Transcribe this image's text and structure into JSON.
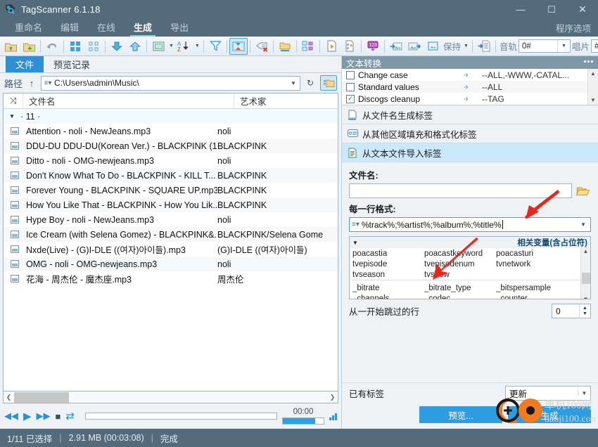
{
  "window": {
    "title": "TagScanner 6.1.18",
    "app_icon": "tag-icon",
    "minimize": "—",
    "maximize": "☐",
    "close": "✕"
  },
  "menubar": {
    "items": [
      {
        "label": "重命名",
        "active": false
      },
      {
        "label": "编辑",
        "active": false
      },
      {
        "label": "在线",
        "active": false
      },
      {
        "label": "生成",
        "active": true
      },
      {
        "label": "导出",
        "active": false
      }
    ],
    "program_options": "程序选项"
  },
  "toolbar": {
    "icons": [
      "open-folder-icon",
      "add-folder-icon",
      "undo-icon",
      "large-icons-icon",
      "small-icons-icon",
      "move-down-icon",
      "move-up-icon",
      "select-box-icon",
      "sort-az-icon",
      "filter-icon",
      "image-swap-icon",
      "clear-tag-icon",
      "folder-icon",
      "tag-structure-icon",
      "play-file-icon",
      "playlist-icon",
      "numbering-icon",
      "import-image-icon",
      "export-image-icon",
      "artwork-icon",
      "export-list-icon"
    ],
    "keep_label": "保持",
    "track_label": "音轨",
    "track_value": "0#",
    "disc_label": "唱片",
    "disc_value": "#"
  },
  "left_panel": {
    "tabs": [
      {
        "label": "文件",
        "active": true
      },
      {
        "label": "预览记录",
        "active": false
      }
    ],
    "path": {
      "label": "路径",
      "up_icon": "arrow-up-icon",
      "value": "C:\\Users\\admin\\Music\\",
      "refresh_icon": "refresh-icon",
      "browse_icon": "browse-folder-icon"
    },
    "columns": {
      "shuffle_icon": "shuffle-icon",
      "filename": "文件名",
      "artist": "艺术家"
    },
    "group_row": "· 11 ·",
    "files": [
      {
        "name": "Attention - noli - NewJeans.mp3",
        "artist": "noli"
      },
      {
        "name": "DDU-DU DDU-DU(Korean Ver.) - BLACKPINK (1...",
        "artist": "BLACKPINK"
      },
      {
        "name": "Ditto - noli - OMG-newjeans.mp3",
        "artist": "noli"
      },
      {
        "name": "Don't Know What To Do - BLACKPINK - KILL T...",
        "artist": "BLACKPINK"
      },
      {
        "name": "Forever Young - BLACKPINK - SQUARE UP.mp3",
        "artist": "BLACKPINK"
      },
      {
        "name": "How You Like That - BLACKPINK - How You Lik...",
        "artist": "BLACKPINK"
      },
      {
        "name": "Hype Boy - noli - NewJeans.mp3",
        "artist": "noli"
      },
      {
        "name": "Ice Cream (with Selena Gomez) - BLACKPINK&...",
        "artist": "BLACKPINK/Selena Gome"
      },
      {
        "name": "Nxde(Live) - (G)I-DLE ((여자)아이들).mp3",
        "artist": "(G)I-DLE ((여자)아이들)"
      },
      {
        "name": "OMG - noli - OMG-newjeans.mp3",
        "artist": "noli"
      },
      {
        "name": "花海 - 周杰伦 - 魔杰座.mp3",
        "artist": "周杰伦"
      }
    ],
    "player": {
      "prev_icon": "rewind-icon",
      "play_icon": "play-icon",
      "next_icon": "fast-forward-icon",
      "stop_icon": "stop-icon",
      "repeat_icon": "repeat-icon",
      "time": "00:00",
      "volume_icon": "volume-bars-icon"
    }
  },
  "right_panel": {
    "text_conversion": {
      "title": "文本转换",
      "menu_icon": "ellipsis-icon",
      "rows": [
        {
          "checked": false,
          "name": "Change case",
          "arrow": "·›",
          "value": "--ALL,-WWW,-CATAL..."
        },
        {
          "checked": false,
          "name": "Standard values",
          "arrow": "·›",
          "value": "--ALL"
        },
        {
          "checked": true,
          "name": "Discogs cleanup",
          "arrow": "·›",
          "value": "--TAG"
        }
      ]
    },
    "actions": [
      {
        "icon": "doc-underline-icon",
        "label": "从文件名生成标签",
        "active": false
      },
      {
        "icon": "field-fill-icon",
        "label": "从其他区域填充和格式化标签",
        "active": false
      },
      {
        "icon": "text-file-icon",
        "label": "从文本文件导入标签",
        "active": true
      }
    ],
    "filename_field": {
      "label": "文件名:",
      "value": "",
      "placeholder": "",
      "browse_icon": "folder-open-icon"
    },
    "line_format": {
      "label": "每一行格式:",
      "value": "%track%;%artist%;%album%;%title%",
      "lines_icon": "list-icon",
      "caret_icon": "chevron-down-icon"
    },
    "variables": {
      "title": "相关变量(含占位符)",
      "collapse_icon": "triangle-down-icon",
      "group1": [
        [
          "poacastia",
          "poacastkeyword",
          "poacasturi"
        ],
        [
          "tvepisode",
          "tvepisodenum",
          "tvnetwork"
        ],
        [
          "tvseason",
          "tvshow",
          ""
        ]
      ],
      "group2": [
        [
          "_bitrate",
          "_bitrate_type",
          "_bitspersample"
        ],
        [
          "_channels",
          "_codec",
          "_counter"
        ]
      ]
    },
    "skip_lines": {
      "label": "从一开始跳过的行",
      "value": "0"
    },
    "existing_tags": {
      "label": "已有标签",
      "value": "更新"
    },
    "buttons": {
      "preview": "预览...",
      "generate": "生成"
    }
  },
  "statusbar": {
    "selection": "1/11 已选择",
    "size": "2.91 MB (00:03:08)",
    "state": "完成",
    "divider": "|"
  },
  "watermark": {
    "title": "单机100网",
    "url": "danji100.com"
  },
  "colors": {
    "titlebar": "#546b7c",
    "accent": "#2f9de0",
    "tab_active": "#2f8fd4",
    "highlight": "#cce9fb",
    "arrow_red": "#e8261b"
  }
}
